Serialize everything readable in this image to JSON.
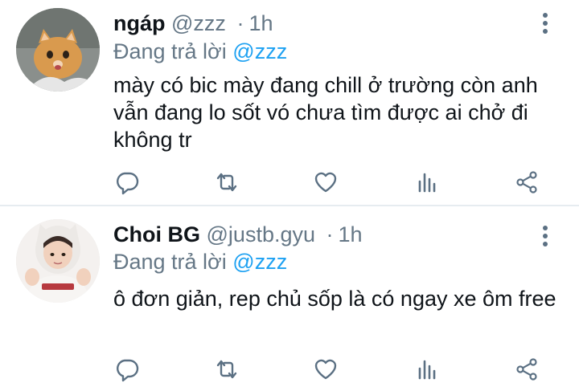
{
  "tweets": [
    {
      "name": "ngáp",
      "handle": "@zzz",
      "separator": "·",
      "time": "1h",
      "reply_prefix": "Đang trả lời",
      "reply_to": "@zzz",
      "text": "mày có bic mày đang chill ở trường còn anh vẫn đang lo sốt vó chưa tìm được ai chở đi không tr",
      "avatar_icon": "cat-avatar"
    },
    {
      "name": "Choi BG",
      "handle": "@justb.gyu",
      "separator": "·",
      "time": "1h",
      "reply_prefix": "Đang trả lời",
      "reply_to": "@zzz",
      "text": "ô đơn giản, rep chủ sốp là có ngay xe ôm free",
      "avatar_icon": "person-avatar"
    }
  ],
  "icons": {
    "reply": "reply-icon",
    "retweet": "retweet-icon",
    "like": "heart-icon",
    "stats": "stats-icon",
    "share": "share-icon",
    "more": "more-vertical-icon"
  },
  "colors": {
    "text": "#0f1419",
    "secondary": "#657786",
    "mention": "#1da1f2",
    "icon": "#5b7083",
    "divider": "#e6ecf0"
  }
}
